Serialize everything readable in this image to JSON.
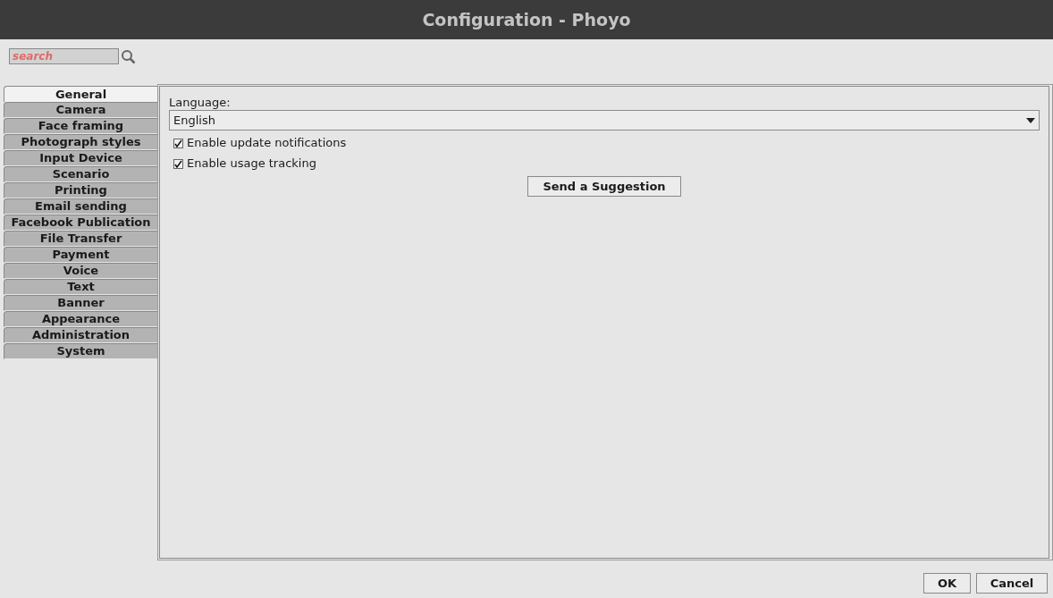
{
  "window": {
    "title": "Configuration - Phoyo"
  },
  "search": {
    "placeholder": "search"
  },
  "tabs": [
    {
      "label": "General",
      "selected": true
    },
    {
      "label": "Camera",
      "selected": false
    },
    {
      "label": "Face framing",
      "selected": false
    },
    {
      "label": "Photograph styles",
      "selected": false
    },
    {
      "label": "Input Device",
      "selected": false
    },
    {
      "label": "Scenario",
      "selected": false
    },
    {
      "label": "Printing",
      "selected": false
    },
    {
      "label": "Email sending",
      "selected": false
    },
    {
      "label": "Facebook Publication",
      "selected": false
    },
    {
      "label": "File Transfer",
      "selected": false
    },
    {
      "label": "Payment",
      "selected": false
    },
    {
      "label": "Voice",
      "selected": false
    },
    {
      "label": "Text",
      "selected": false
    },
    {
      "label": "Banner",
      "selected": false
    },
    {
      "label": "Appearance",
      "selected": false
    },
    {
      "label": "Administration",
      "selected": false
    },
    {
      "label": "System",
      "selected": false
    }
  ],
  "general": {
    "language_label": "Language:",
    "language_value": "English",
    "checkboxes": [
      {
        "label": "Enable update notifications",
        "checked": true
      },
      {
        "label": "Enable usage tracking",
        "checked": true
      }
    ],
    "suggestion_button": "Send a Suggestion"
  },
  "buttons": [
    "OK",
    "Cancel"
  ]
}
